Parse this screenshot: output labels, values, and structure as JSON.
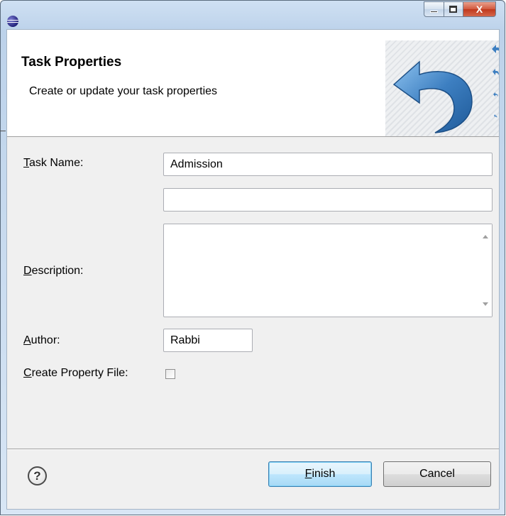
{
  "window": {
    "title": "",
    "controls": {
      "minimize": "minimize",
      "maximize": "maximize",
      "close": "X"
    }
  },
  "banner": {
    "title": "Task Properties",
    "subtitle": "Create or update your task properties",
    "image_icon": "undo-arrow-icon"
  },
  "form": {
    "task_name": {
      "label_mnemonic": "T",
      "label_rest": "ask Name:",
      "value": "Admission"
    },
    "second_field": {
      "value": ""
    },
    "description": {
      "label_mnemonic": "D",
      "label_rest": "escription:",
      "value": ""
    },
    "author": {
      "label_mnemonic": "A",
      "label_rest": "uthor:",
      "value": "Rabbi"
    },
    "create_property_file": {
      "label_mnemonic": "C",
      "label_rest": "reate Property File:",
      "checked": false
    }
  },
  "footer": {
    "help_label": "?",
    "finish": {
      "mnemonic": "F",
      "rest": "inish"
    },
    "cancel": "Cancel"
  },
  "colors": {
    "accent": "#3c7fb1",
    "arrow_blue": "#3d7fc1",
    "close_red": "#c0391d"
  }
}
